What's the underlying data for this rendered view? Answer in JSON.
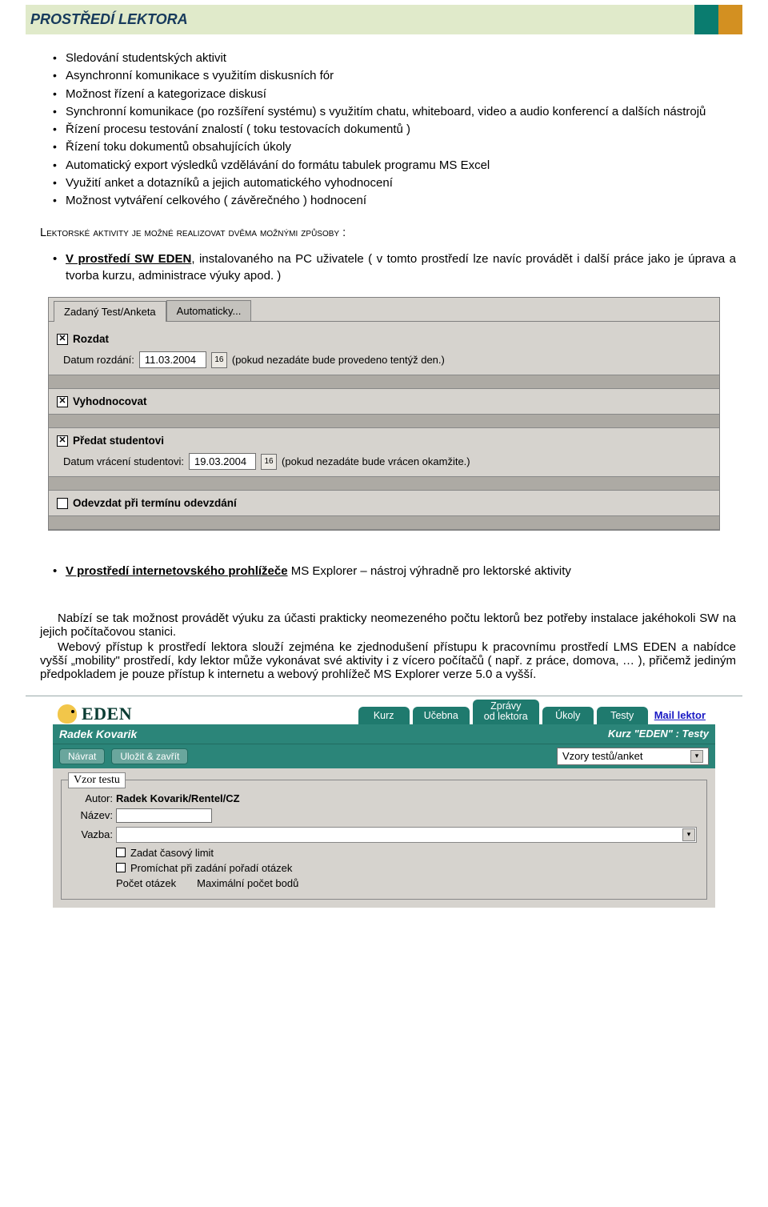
{
  "header": {
    "title": "PROSTŘEDÍ LEKTORA"
  },
  "bullets": [
    "Sledování studentských aktivit",
    "Asynchronní komunikace s využitím diskusních fór",
    "Možnost řízení a kategorizace diskusí",
    "Synchronní komunikace (po rozšíření systému) s využitím chatu, whiteboard, video a audio konferencí a dalších nástrojů",
    "Řízení procesu testování znalostí ( toku testovacích dokumentů )",
    "Řízení toku dokumentů obsahujících úkoly",
    "Automatický export výsledků vzdělávání do formátu tabulek programu MS Excel",
    "Využití anket a dotazníků a jejich  automatického vyhodnocení",
    "Možnost vytváření celkového ( závěrečného ) hodnocení"
  ],
  "small_caps_line": "Lektorské aktivity je možné realizovat dvěma možnými způsoby :",
  "sub1": {
    "lead_underlined": "V prostředí SW EDEN",
    "rest": ", instalovaného na PC uživatele ( v tomto prostředí lze navíc provádět i další práce jako je úprava a tvorba kurzu, administrace výuky apod. )"
  },
  "shot1": {
    "tab_active": "Zadaný Test/Anketa",
    "tab_inactive": "Automaticky...",
    "chk_rozdat": "Rozdat",
    "date1_label": "Datum rozdání:",
    "date1_value": "11.03.2004",
    "date1_btn": "16",
    "date1_hint": "(pokud nezadáte bude provedeno tentýž den.)",
    "chk_vyhod": "Vyhodnocovat",
    "chk_predat": "Předat studentovi",
    "date2_label": "Datum vrácení studentovi:",
    "date2_value": "19.03.2004",
    "date2_btn": "16",
    "date2_hint": "(pokud nezadáte bude vrácen okamžite.)",
    "chk_odevzdat": "Odevzdat při termínu odevzdání"
  },
  "sub2": {
    "lead_underlined": "V prostředí internetovského prohlížeče",
    "rest": " MS Explorer – nástroj výhradně pro lektorské aktivity"
  },
  "para1": "Nabízí se tak možnost provádět výuku za účasti prakticky neomezeného počtu lektorů bez potřeby instalace jakéhokoli SW na jejich počítačovou stanici.",
  "para2": "Webový přístup k prostředí lektora slouží zejména ke zjednodušení přístupu k pracovnímu prostředí LMS EDEN a nabídce vyšší „mobility\" prostředí, kdy lektor může vykonávat své aktivity i z vícero počítačů ( např. z práce, domova, … ), přičemž jediným předpokladem je pouze přístup k internetu a webový prohlížeč MS Explorer verze 5.0 a vyšší.",
  "eden": {
    "logo": "EDEN",
    "mail": "Mail lektor",
    "tabs": {
      "kurz": "Kurz",
      "ucebna": "Učebna",
      "zpravy_l1": "Zprávy",
      "zpravy_l2": "od lektora",
      "ukoly": "Úkoly",
      "testy": "Testy"
    },
    "user": "Radek Kovarik",
    "crumb": "Kurz \"EDEN\" : Testy",
    "btn_navrat": "Návrat",
    "btn_ulozit": "Uložit & zavřít",
    "select_value": "Vzory testů/anket",
    "legend": "Vzor testu",
    "rows": {
      "autor_lbl": "Autor:",
      "autor_val": "Radek Kovarik/Rentel/CZ",
      "nazev_lbl": "Název:",
      "vazba_lbl": "Vazba:"
    },
    "opts": {
      "cas": "Zadat časový limit",
      "promichat": "Promíchat při zadání pořadí otázek",
      "pocet": "Počet otázek",
      "max": "Maximální počet bodů"
    }
  }
}
